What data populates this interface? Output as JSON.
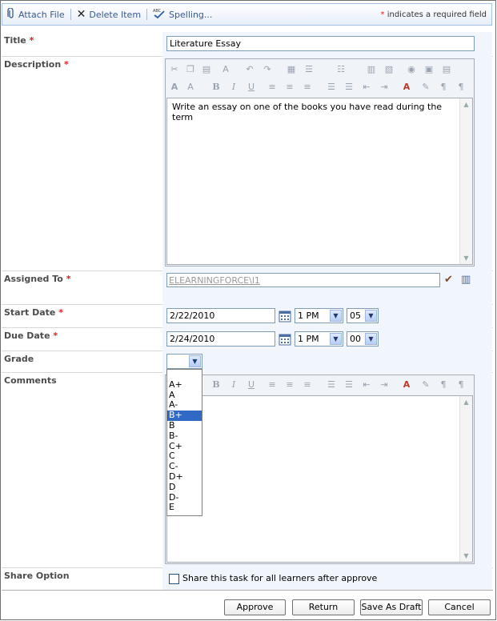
{
  "toolbar": {
    "attach": "Attach File",
    "delete": "Delete Item",
    "spelling": "Spelling...",
    "required_star": "*",
    "required_text": "indicates a required field"
  },
  "fields": {
    "title": {
      "label": "Title",
      "star": "*",
      "value": "Literature Essay"
    },
    "description": {
      "label": "Description",
      "star": "*",
      "value": "Write an essay on one of the books you have read during the term"
    },
    "assigned": {
      "label": "Assigned To",
      "star": "*",
      "value": "ELEARNINGFORCE\\l1"
    },
    "start": {
      "label": "Start Date",
      "star": "*",
      "date": "2/22/2010",
      "hour": "1 PM",
      "minute": "05"
    },
    "due": {
      "label": "Due Date",
      "star": "*",
      "date": "2/24/2010",
      "hour": "1 PM",
      "minute": "00"
    },
    "grade": {
      "label": "Grade",
      "value": ""
    },
    "comments": {
      "label": "Comments"
    },
    "share": {
      "label": "Share Option",
      "text": "Share this task for all learners after approve"
    }
  },
  "grade_options": [
    "",
    "A+",
    "A",
    "A-",
    "B+",
    "B",
    "B-",
    "C+",
    "C",
    "C-",
    "D+",
    "D",
    "D-",
    "E"
  ],
  "grade_selected": "B+",
  "buttons": {
    "approve": "Approve",
    "return": "Return",
    "save_draft": "Save As Draft",
    "cancel": "Cancel"
  }
}
